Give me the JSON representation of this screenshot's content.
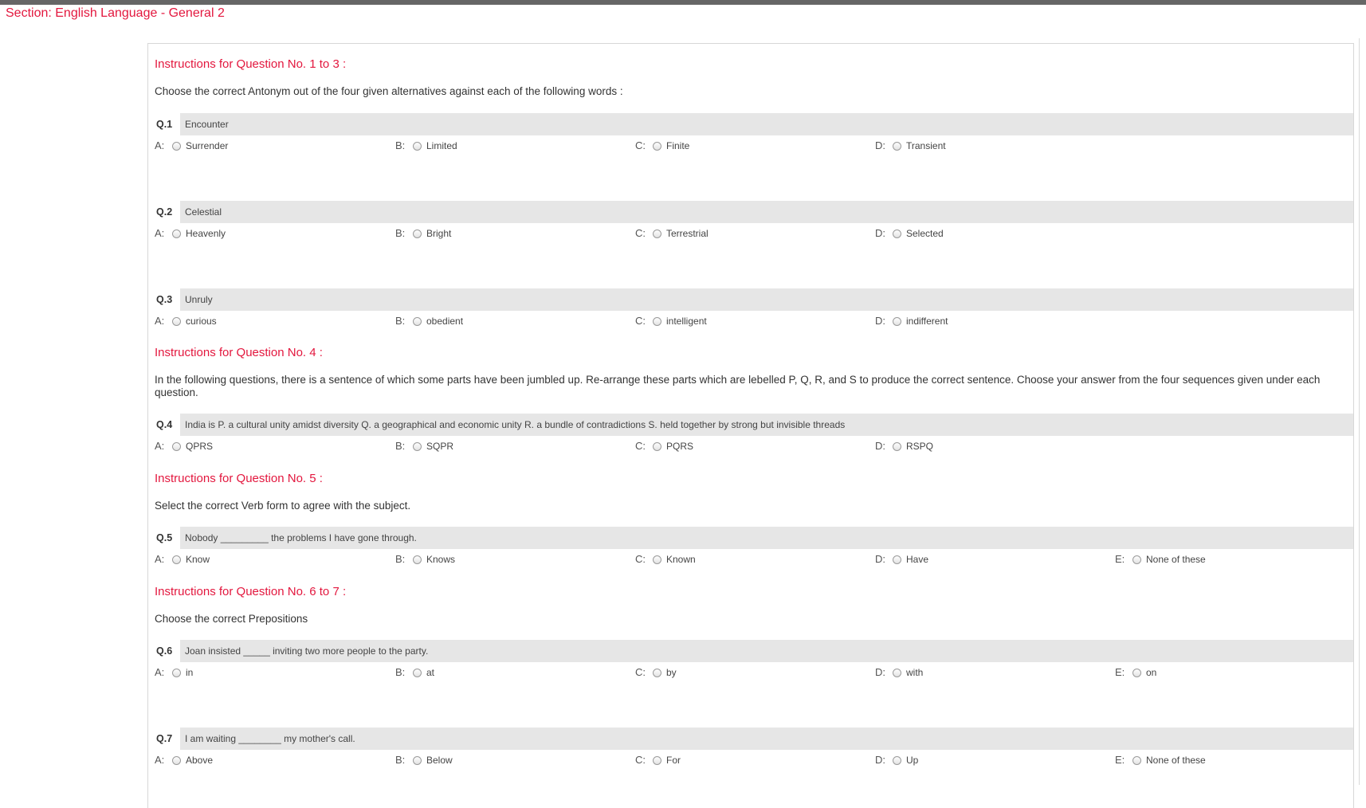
{
  "section_title": "Section: English Language - General 2",
  "groups": [
    {
      "title": "Instructions for Question No. 1 to 3 :",
      "text": "Choose the correct Antonym out of the four given alternatives against each of the following words :",
      "questions": [
        {
          "num": "Q.1",
          "text": "Encounter",
          "options": [
            {
              "letter": "A:",
              "text": "Surrender"
            },
            {
              "letter": "B:",
              "text": "Limited"
            },
            {
              "letter": "C:",
              "text": "Finite"
            },
            {
              "letter": "D:",
              "text": "Transient"
            }
          ]
        },
        {
          "num": "Q.2",
          "text": "Celestial",
          "options": [
            {
              "letter": "A:",
              "text": "Heavenly"
            },
            {
              "letter": "B:",
              "text": "Bright"
            },
            {
              "letter": "C:",
              "text": "Terrestrial"
            },
            {
              "letter": "D:",
              "text": "Selected"
            }
          ]
        },
        {
          "num": "Q.3",
          "text": "Unruly",
          "options": [
            {
              "letter": "A:",
              "text": "curious"
            },
            {
              "letter": "B:",
              "text": "obedient"
            },
            {
              "letter": "C:",
              "text": "intelligent"
            },
            {
              "letter": "D:",
              "text": "indifferent"
            }
          ]
        }
      ]
    },
    {
      "title": "Instructions for Question No. 4 :",
      "text": "In the following questions, there is a sentence of which some parts have been jumbled up. Re-arrange these parts which are lebelled P, Q, R, and S to produce the correct sentence. Choose your answer from the four sequences given under each question.",
      "questions": [
        {
          "num": "Q.4",
          "text": "India is P. a cultural unity amidst diversity Q. a geographical and economic unity R. a bundle of contradictions S. held together by strong but invisible threads",
          "options": [
            {
              "letter": "A:",
              "text": "QPRS"
            },
            {
              "letter": "B:",
              "text": "SQPR"
            },
            {
              "letter": "C:",
              "text": "PQRS"
            },
            {
              "letter": "D:",
              "text": "RSPQ"
            }
          ]
        }
      ]
    },
    {
      "title": "Instructions for Question No. 5 :",
      "text": "Select the correct Verb form to agree with the subject.",
      "questions": [
        {
          "num": "Q.5",
          "text": "Nobody _________ the problems I have gone through.",
          "options": [
            {
              "letter": "A:",
              "text": "Know"
            },
            {
              "letter": "B:",
              "text": "Knows"
            },
            {
              "letter": "C:",
              "text": "Known"
            },
            {
              "letter": "D:",
              "text": "Have"
            },
            {
              "letter": "E:",
              "text": "None of these"
            }
          ]
        }
      ]
    },
    {
      "title": "Instructions for Question No. 6 to 7 :",
      "text": "Choose the correct Prepositions",
      "questions": [
        {
          "num": "Q.6",
          "text": "Joan insisted _____ inviting two more people to the party.",
          "options": [
            {
              "letter": "A:",
              "text": "in"
            },
            {
              "letter": "B:",
              "text": "at"
            },
            {
              "letter": "C:",
              "text": "by"
            },
            {
              "letter": "D:",
              "text": "with"
            },
            {
              "letter": "E:",
              "text": "on"
            }
          ]
        },
        {
          "num": "Q.7",
          "text": "I am waiting ________ my mother's call.",
          "options": [
            {
              "letter": "A:",
              "text": "Above"
            },
            {
              "letter": "B:",
              "text": "Below"
            },
            {
              "letter": "C:",
              "text": "For"
            },
            {
              "letter": "D:",
              "text": "Up"
            },
            {
              "letter": "E:",
              "text": "None of these"
            }
          ]
        }
      ]
    }
  ]
}
